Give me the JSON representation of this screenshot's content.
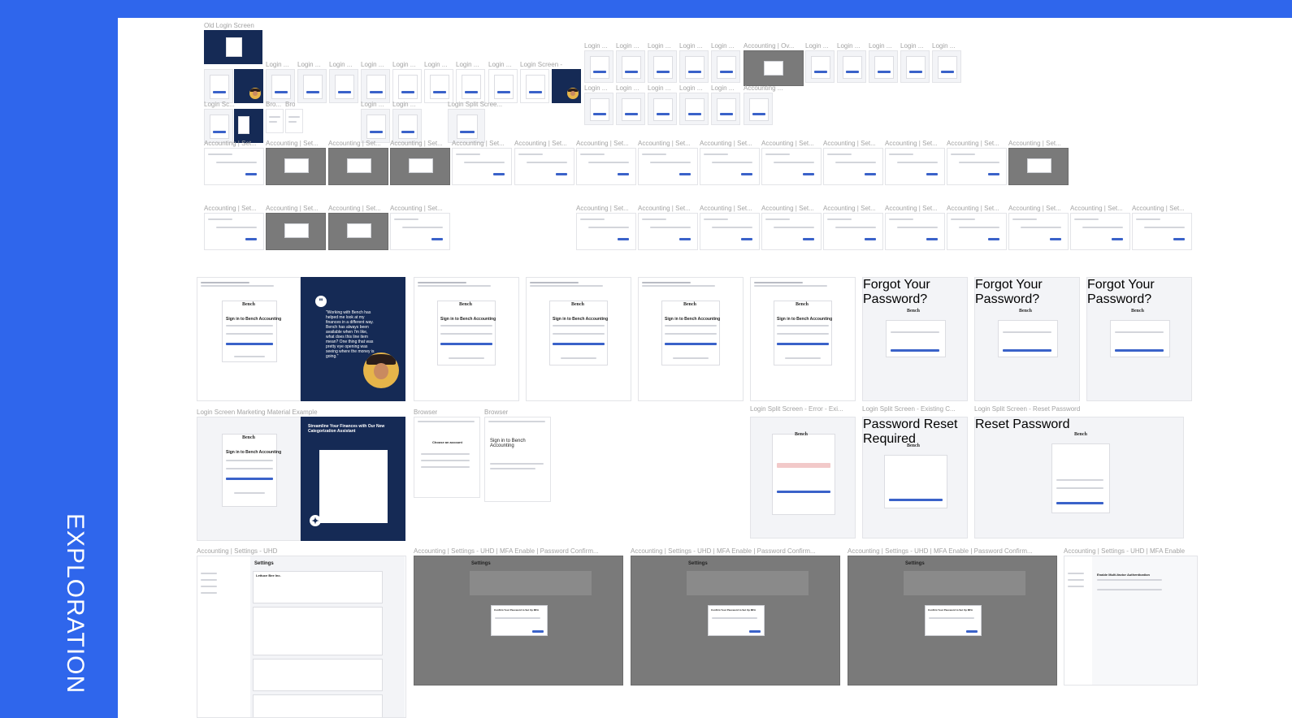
{
  "section_title": "EXPLORATION",
  "colors": {
    "accent": "#2f66ec",
    "navy": "#152a55",
    "primary_button": "#3a62c9"
  },
  "labels": {
    "old_login": "Old Login Screen",
    "login": "Login ...",
    "login_screen": "Login Screen -",
    "login_split": "Login Split Scree...",
    "login_sc": "Login Sc...",
    "bro": "Bro...",
    "bro2": "Bro",
    "accounting_ov": "Accounting | Ov...",
    "accounting": "Accounting ...",
    "accounting_set": "Accounting | Set...",
    "login_marketing": "Login Screen Marketing Material Example",
    "browser": "Browser",
    "split_error": "Login Split Screen - Error - Exi...",
    "split_existing": "Login Split Screen - Existing C...",
    "split_reset": "Login Split Screen - Reset Password",
    "settings_uhd": "Accounting | Settings - UHD",
    "settings_mfa_confirm": "Accounting | Settings - UHD | MFA Enable | Password Confirm...",
    "settings_mfa_enable": "Accounting | Settings - UHD | MFA Enable"
  },
  "thumb_text": {
    "logo": "Bench",
    "sign_in": "Sign in to Bench Accounting",
    "forgot": "Forgot Your Password?",
    "pwd_reset_required": "Password Reset Required",
    "reset_password": "Reset Password",
    "quote": "\"Working with Bench has helped me look at my finances in a different way. Bench has always been available when I'm like, what does this line item mean? One thing that was pretty eye opening was seeing where the money is going.\"",
    "marketing_headline": "Streamline Your Finances with Our New Categorization Assistant",
    "choose_account": "Choose an account",
    "sign_in_short": "Sign in to Bench Accounting",
    "settings": "Settings",
    "company": "Lettuce Bee Inc.",
    "confirm_pw": "Confirm Your Password to Set Up MFA",
    "enable_mfa": "Enable Multi-factor Authentication"
  }
}
